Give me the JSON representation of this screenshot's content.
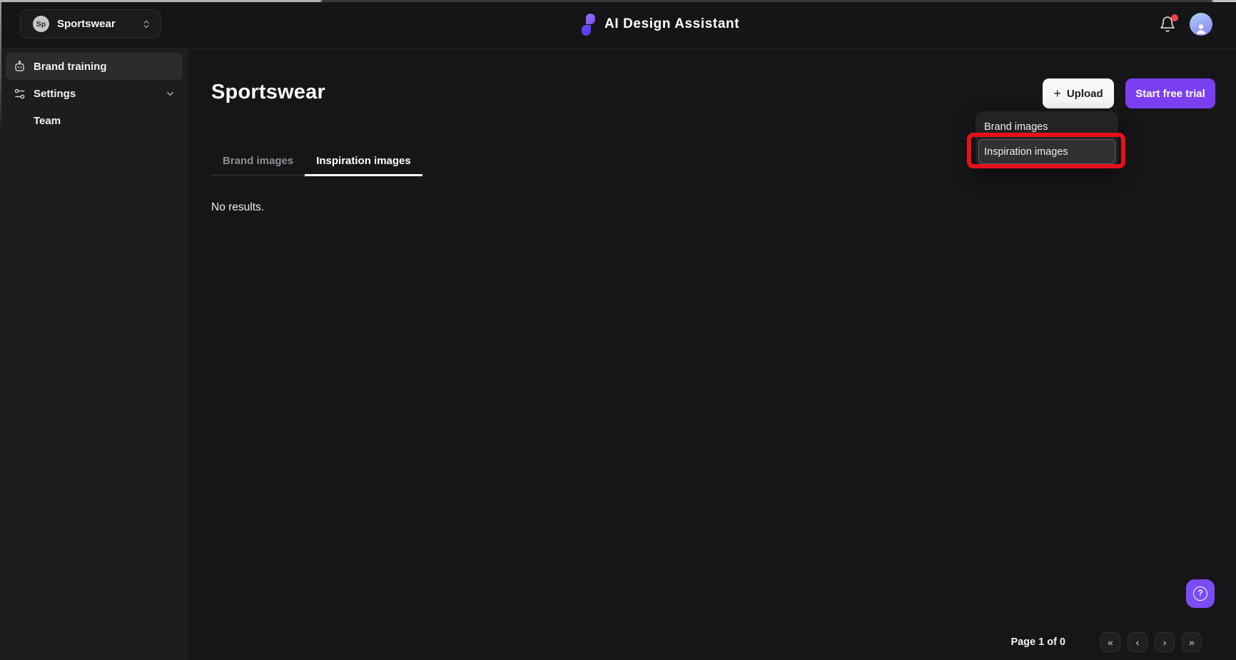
{
  "topbar": {
    "workspace": {
      "badge": "Sp",
      "name": "Sportswear"
    },
    "logo_text": "AI Design Assistant"
  },
  "sidebar": {
    "items": [
      {
        "label": "Brand training",
        "icon": "bot-icon",
        "active": true
      },
      {
        "label": "Settings",
        "icon": "sliders-icon",
        "expandable": true
      },
      {
        "label": "Team",
        "icon": "none"
      }
    ]
  },
  "main": {
    "title": "Sportswear",
    "actions": {
      "upload_plus": "+",
      "upload_label": "Upload",
      "trial_label": "Start free trial"
    },
    "tabs": [
      {
        "label": "Brand images",
        "active": false
      },
      {
        "label": "Inspiration images",
        "active": true
      }
    ],
    "empty_state": "No results."
  },
  "upload_menu": {
    "items": [
      {
        "label": "Brand images",
        "highlighted": false
      },
      {
        "label": "Inspiration images",
        "highlighted": true
      }
    ]
  },
  "help": {
    "glyph": "?"
  },
  "pagination": {
    "label": "Page 1 of 0",
    "buttons": [
      {
        "name": "first-page",
        "glyph": "«"
      },
      {
        "name": "previous-page",
        "glyph": "‹"
      },
      {
        "name": "next-page",
        "glyph": "›"
      },
      {
        "name": "last-page",
        "glyph": "»"
      }
    ]
  },
  "icons": {
    "workspace_switcher": "chevrons-up-down",
    "brand_training": "bot",
    "settings": "sliders",
    "settings_trailing": "chevron-down",
    "notifications": "bell",
    "user": "avatar-person",
    "help": "help-circle"
  },
  "colors": {
    "page_bg": "#161618",
    "sidebar_bg": "#1d1d1e",
    "accent_purple": "#7b3ff2",
    "help_purple": "#7b4df7",
    "annotation_red": "#e8101d",
    "notification_dot": "#ee4150",
    "upload_button_bg": "#f7f7f6",
    "active_tab_underline": "#ffffff"
  }
}
